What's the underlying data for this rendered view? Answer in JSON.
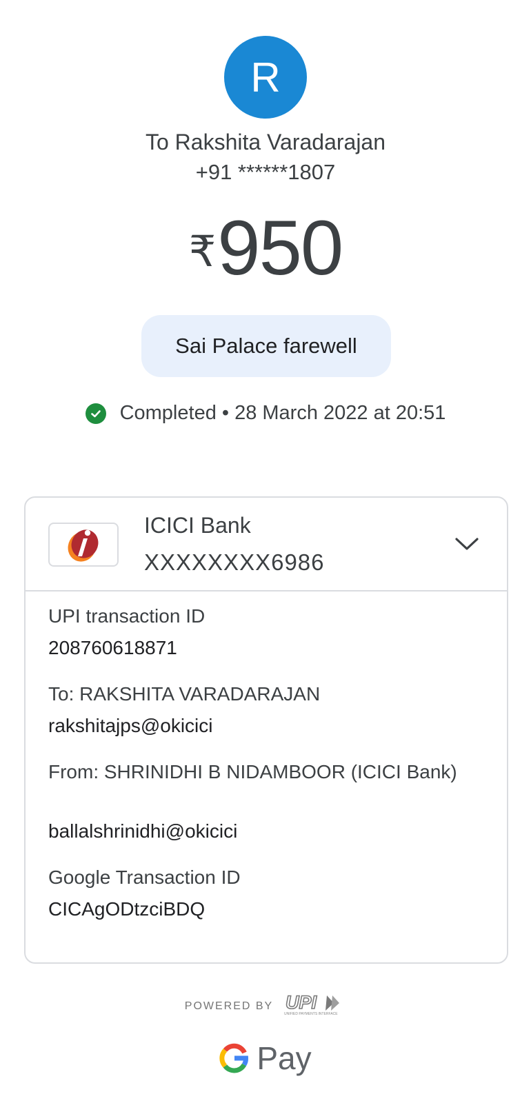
{
  "avatar": {
    "letter": "R",
    "color": "#1a88d4"
  },
  "recipient": {
    "name": "To Rakshita Varadarajan",
    "phone": "+91 ******1807"
  },
  "amount": {
    "currency": "₹",
    "value": "950"
  },
  "note": "Sai Palace farewell",
  "status": {
    "icon": "check-circle-icon",
    "text": "Completed • 28 March 2022 at 20:51",
    "color": "#1e8e3e"
  },
  "bank": {
    "name": "ICICI Bank",
    "account": "XXXXXXXX6986",
    "icon": "chevron-down-icon"
  },
  "details": {
    "upi_label": "UPI transaction ID",
    "upi_value": "208760618871",
    "to_label": "To: RAKSHITA VARADARAJAN",
    "to_value": "rakshitajps@okicici",
    "from_label": "From: SHRINIDHI B NIDAMBOOR (ICICI Bank)",
    "from_value": "ballalshrinidhi@okicici",
    "google_label": "Google Transaction ID",
    "google_value": "CICAgODtzciBDQ"
  },
  "footer": {
    "powered_by": "POWERED BY",
    "upi_logo": "UPI",
    "upi_tagline": "UNIFIED PAYMENTS INTERFACE",
    "brand": "Pay"
  }
}
